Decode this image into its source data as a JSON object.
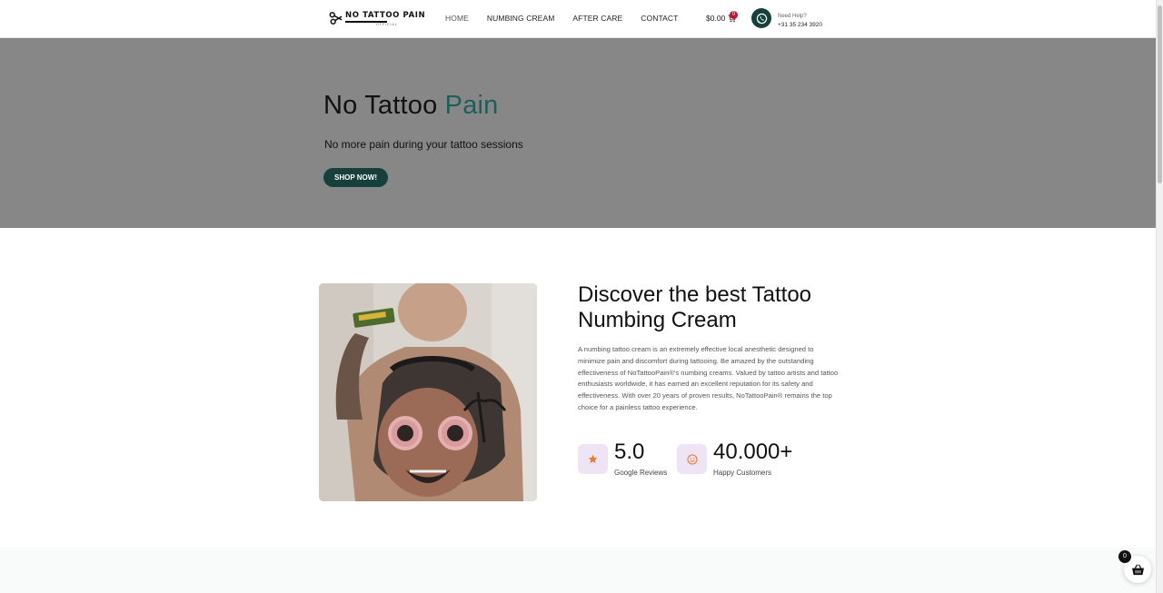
{
  "header": {
    "logo": {
      "name": "NO TATTOO PAIN",
      "sub": "OFFICIAL"
    },
    "nav": [
      {
        "label": "HOME"
      },
      {
        "label": "NUMBING CREAM"
      },
      {
        "label": "AFTER CARE"
      },
      {
        "label": "CONTACT"
      }
    ],
    "cart": {
      "total": "$0.00",
      "count": "0"
    },
    "help": {
      "label": "Need Help?",
      "phone": "+31 35 234 3920"
    }
  },
  "hero": {
    "title_main": "No Tattoo ",
    "title_accent": "Pain",
    "subtitle": "No more pain during your tattoo sessions",
    "button": "SHOP NOW!"
  },
  "about": {
    "title": "Discover the best Tattoo Numbing Cream",
    "body": "A numbing tattoo cream is an extremely effective local anesthetic designed to minimize pain and discomfort during tattooing. Be amazed by the outstanding effectiveness of NoTattooPain®'s numbing creams. Valued by tattoo artists and tattoo enthusiasts worldwide, it has earned an excellent reputation for its safety and effectiveness. With over 20 years of proven results, NoTattooPain® remains the top choice for a painless tattoo experience.",
    "stats": [
      {
        "value": "5.0",
        "label": "Google Reviews",
        "icon": "star-icon"
      },
      {
        "value": "40.000+",
        "label": "Happy Customers",
        "icon": "smiley-icon"
      }
    ]
  },
  "floating_cart": {
    "count": "0"
  },
  "colors": {
    "brand": "#173f3b",
    "accent": "#1e5e5a",
    "hero_bg": "#878787",
    "badge": "#c8102e",
    "stat_icon_bg": "#efe3f6",
    "icon_orange": "#e8792b"
  }
}
